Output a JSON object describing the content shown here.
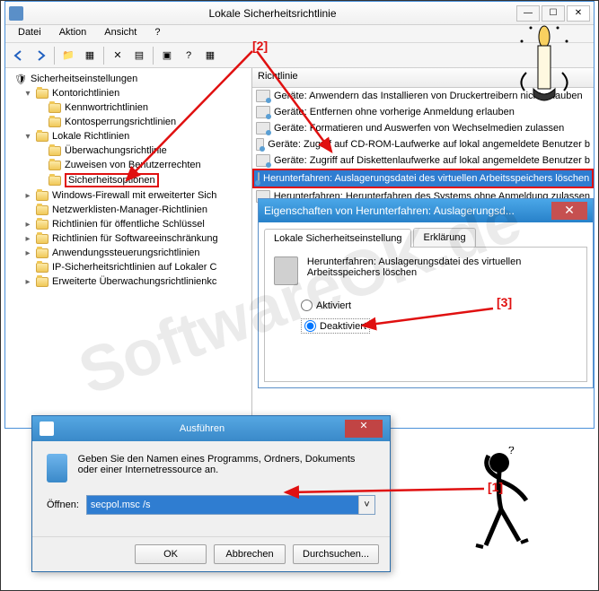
{
  "window": {
    "title": "Lokale Sicherheitsrichtlinie",
    "menu": [
      "Datei",
      "Aktion",
      "Ansicht",
      "?"
    ]
  },
  "tree": {
    "root": "Sicherheitseinstellungen",
    "items": [
      {
        "label": "Kontorichtlinien",
        "indent": 1,
        "toggle": "▾"
      },
      {
        "label": "Kennwortrichtlinien",
        "indent": 2,
        "toggle": ""
      },
      {
        "label": "Kontosperrungsrichtlinien",
        "indent": 2,
        "toggle": ""
      },
      {
        "label": "Lokale Richtlinien",
        "indent": 1,
        "toggle": "▾"
      },
      {
        "label": "Überwachungsrichtlinie",
        "indent": 2,
        "toggle": ""
      },
      {
        "label": "Zuweisen von Benutzerrechten",
        "indent": 2,
        "toggle": ""
      },
      {
        "label": "Sicherheitsoptionen",
        "indent": 2,
        "toggle": "",
        "boxed": true
      },
      {
        "label": "Windows-Firewall mit erweiterter Sich",
        "indent": 1,
        "toggle": "▸"
      },
      {
        "label": "Netzwerklisten-Manager-Richtlinien",
        "indent": 1,
        "toggle": ""
      },
      {
        "label": "Richtlinien für öffentliche Schlüssel",
        "indent": 1,
        "toggle": "▸"
      },
      {
        "label": "Richtlinien für Softwareeinschränkung",
        "indent": 1,
        "toggle": "▸"
      },
      {
        "label": "Anwendungssteuerungsrichtlinien",
        "indent": 1,
        "toggle": "▸"
      },
      {
        "label": "IP-Sicherheitsrichtlinien auf Lokaler C",
        "indent": 1,
        "toggle": ""
      },
      {
        "label": "Erweiterte Überwachungsrichtlinienkc",
        "indent": 1,
        "toggle": "▸"
      }
    ]
  },
  "list": {
    "header": "Richtlinie",
    "rows": [
      "Geräte: Anwendern das Installieren von Druckertreibern nicht erlauben",
      "Geräte: Entfernen ohne vorherige Anmeldung erlauben",
      "Geräte: Formatieren und Auswerfen von Wechselmedien zulassen",
      "Geräte: Zugriff auf CD-ROM-Laufwerke auf lokal angemeldete Benutzer b",
      "Geräte: Zugriff auf Diskettenlaufwerke auf lokal angemeldete Benutzer b",
      "Herunterfahren: Auslagerungsdatei des virtuellen Arbeitsspeichers löschen",
      "Herunterfahren: Herunterfahren des Systems ohne Anmeldung zulassen"
    ],
    "selected_index": 5
  },
  "props": {
    "title": "Eigenschaften von Herunterfahren: Auslagerungsd...",
    "tab1": "Lokale Sicherheitseinstellung",
    "tab2": "Erklärung",
    "description": "Herunterfahren: Auslagerungsdatei des virtuellen Arbeitsspeichers löschen",
    "opt_enabled": "Aktiviert",
    "opt_disabled": "Deaktiviert"
  },
  "run": {
    "title": "Ausführen",
    "description": "Geben Sie den Namen eines Programms, Ordners, Dokuments oder einer Internetressource an.",
    "open_label": "Öffnen:",
    "value": "secpol.msc /s",
    "ok": "OK",
    "cancel": "Abbrechen",
    "browse": "Durchsuchen..."
  },
  "annotations": {
    "a1": "[1]",
    "a2": "[2]",
    "a3": "[3]"
  },
  "watermark": "SoftwareOK.de"
}
